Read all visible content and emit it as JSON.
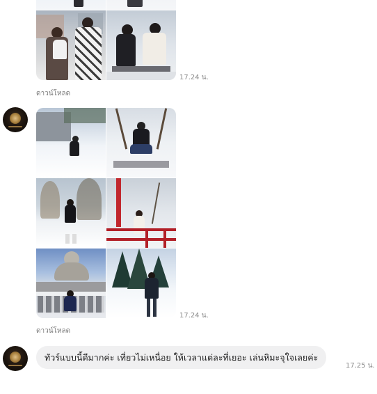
{
  "messages": [
    {
      "type": "image_grid",
      "time": "17.24 น.",
      "download_label": "ดาวน์โหลด",
      "photos": [
        {
          "name": "snow-portrait-photo"
        },
        {
          "name": "snow-portrait-photo"
        },
        {
          "name": "couple-in-city-photo"
        },
        {
          "name": "women-on-bench-photo"
        }
      ]
    },
    {
      "type": "image_grid",
      "time": "17.24 น.",
      "download_label": "ดาวน์โหลด",
      "photos": [
        {
          "name": "snowfield-building-photo"
        },
        {
          "name": "man-on-bench-photo"
        },
        {
          "name": "snow-trees-photo"
        },
        {
          "name": "red-railing-photo"
        },
        {
          "name": "buddha-statue-photo"
        },
        {
          "name": "man-pine-forest-photo"
        }
      ]
    },
    {
      "type": "text",
      "time": "17.25 น.",
      "text": "ทัวร์แบบนี้ดีมากค่ะ เที่ยวไม่เหนื่อย ให้เวลาแต่ละที่เยอะ เล่นหิมะจุใจเลยค่ะ"
    }
  ]
}
